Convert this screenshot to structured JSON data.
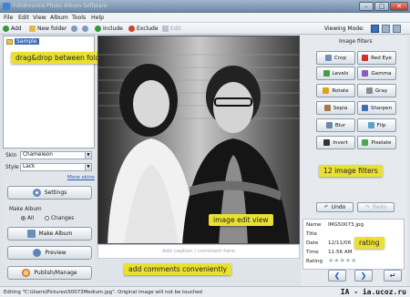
{
  "window": {
    "title": "Fotobounce Photo Album Software"
  },
  "menu": [
    "File",
    "Edit",
    "View",
    "Album",
    "Tools",
    "Help"
  ],
  "toolbar": {
    "add": "Add",
    "new_folder": "New folder",
    "include": "Include",
    "exclude": "Exclude",
    "edit": "Edit",
    "viewing_mode": "Viewing Mode:"
  },
  "tree": {
    "selected_folder": "Sample"
  },
  "callouts": {
    "drag_drop": "drag&drop between folders",
    "filters": "12 image filters",
    "edit_view": "image edit view",
    "rating": "rating",
    "comments": "add comments conveniently"
  },
  "left_panel": {
    "skin_label": "Skin",
    "skin_value": "Chameleon",
    "style_label": "Style",
    "style_value": "Lack",
    "more_skins": "More skins",
    "settings": "Settings",
    "make_album_label": "Make Album",
    "radio_all": "All",
    "radio_changes": "Changes",
    "make_album_button": "Make Album",
    "preview": "Preview",
    "publish": "Publish/Manage"
  },
  "filters": {
    "title": "Image filters",
    "items": [
      "Crop",
      "Red Eye",
      "Levels",
      "Gamma",
      "Rotate",
      "Gray",
      "Sepia",
      "Sharpen",
      "Blur",
      "Flip",
      "Invert",
      "Pixelate"
    ],
    "undo": "Undo",
    "redo": "Redo"
  },
  "info": {
    "name_label": "Name",
    "name_value": "IMG50073.jpg",
    "title_label": "Title",
    "date_label": "Date",
    "date_value": "12/11/06",
    "time_label": "Time",
    "time_value": "11:56 AM",
    "rating_label": "Rating",
    "rating_stars": 0,
    "rating_max": 5
  },
  "caption": {
    "placeholder": "Add caption / comment here"
  },
  "status": {
    "message": "Editing \"C:\\Users\\Pictures\\50073Medium.jpg\". Original image will not be touched",
    "watermark": "IA - ia.ucoz.ru"
  },
  "colors": {
    "callout": "#e9e032",
    "accent": "#3d6fb4",
    "photo_bg": "#111111"
  }
}
